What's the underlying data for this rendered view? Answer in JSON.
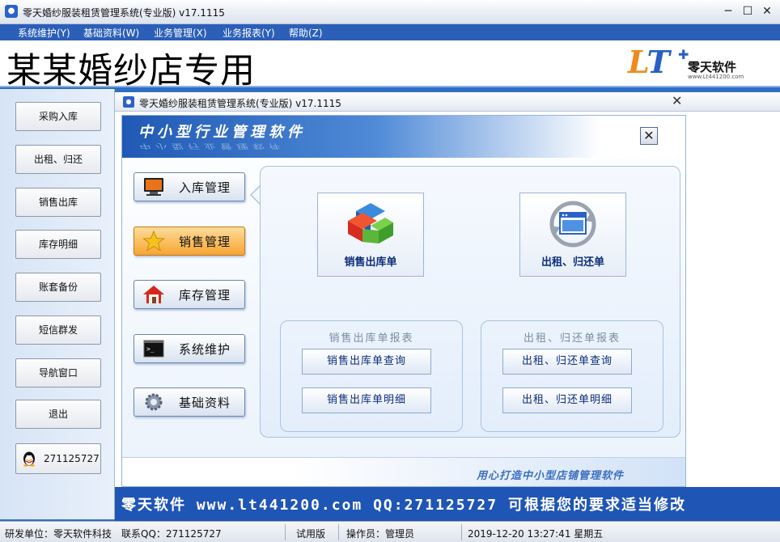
{
  "window": {
    "title": "零天婚纱服装租赁管理系统(专业版)  v17.1115",
    "app_icon": "app-icon",
    "controls": {
      "minimize": "─",
      "maximize": "☐",
      "close": "✕"
    }
  },
  "menu": {
    "items": [
      "系统维护(Y)",
      "基础资料(W)",
      "业务管理(X)",
      "业务报表(Y)",
      "帮助(Z)"
    ]
  },
  "banner": {
    "shop_name": "某某婚纱店专用",
    "logo": {
      "mark_l": "L",
      "mark_t": "T",
      "plus": "✚",
      "name": "零天软件",
      "url": "www.Lt441200.com"
    }
  },
  "sidebar": {
    "items": [
      "采购入库",
      "出租、归还",
      "销售出库",
      "库存明细",
      "账套备份",
      "短信群发",
      "导航窗口",
      "退出"
    ],
    "qq": "271125727"
  },
  "inner_window": {
    "title": "零天婚纱服装租赁管理系统(专业版)  v17.1115",
    "close": "✕",
    "header_title": "中小型行业管理软件",
    "header_close": "✕",
    "nav": [
      {
        "label": "入库管理",
        "icon": "monitor-icon"
      },
      {
        "label": "销售管理",
        "icon": "star-icon"
      },
      {
        "label": "库存管理",
        "icon": "home-icon"
      },
      {
        "label": "系统维护",
        "icon": "terminal-icon"
      },
      {
        "label": "基础资料",
        "icon": "gear-icon"
      }
    ],
    "active_nav": 1,
    "big_buttons": [
      "销售出库单",
      "出租、归还单"
    ],
    "groups": [
      {
        "title": "销售出库单报表",
        "buttons": [
          "销售出库单查询",
          "销售出库单明细"
        ]
      },
      {
        "title": "出租、归还单报表",
        "buttons": [
          "出租、归还单查询",
          "出租、归还单明细"
        ]
      }
    ],
    "slogan": "用心打造中小型店铺管理软件",
    "footer": "零天软件  www.lt441200.com  QQ:271125727  可根据您的要求适当修改"
  },
  "status": {
    "dev_unit": "研发单位：零天软件科技",
    "contact": "联系QQ：271125727",
    "edition": "试用版",
    "operator": "操作员：管理员",
    "datetime": "2019-12-20 13:27:41 星期五"
  },
  "colors": {
    "accent": "#1f55b4",
    "active_nav": "#f7a531",
    "text_link": "#0c2f7a"
  }
}
